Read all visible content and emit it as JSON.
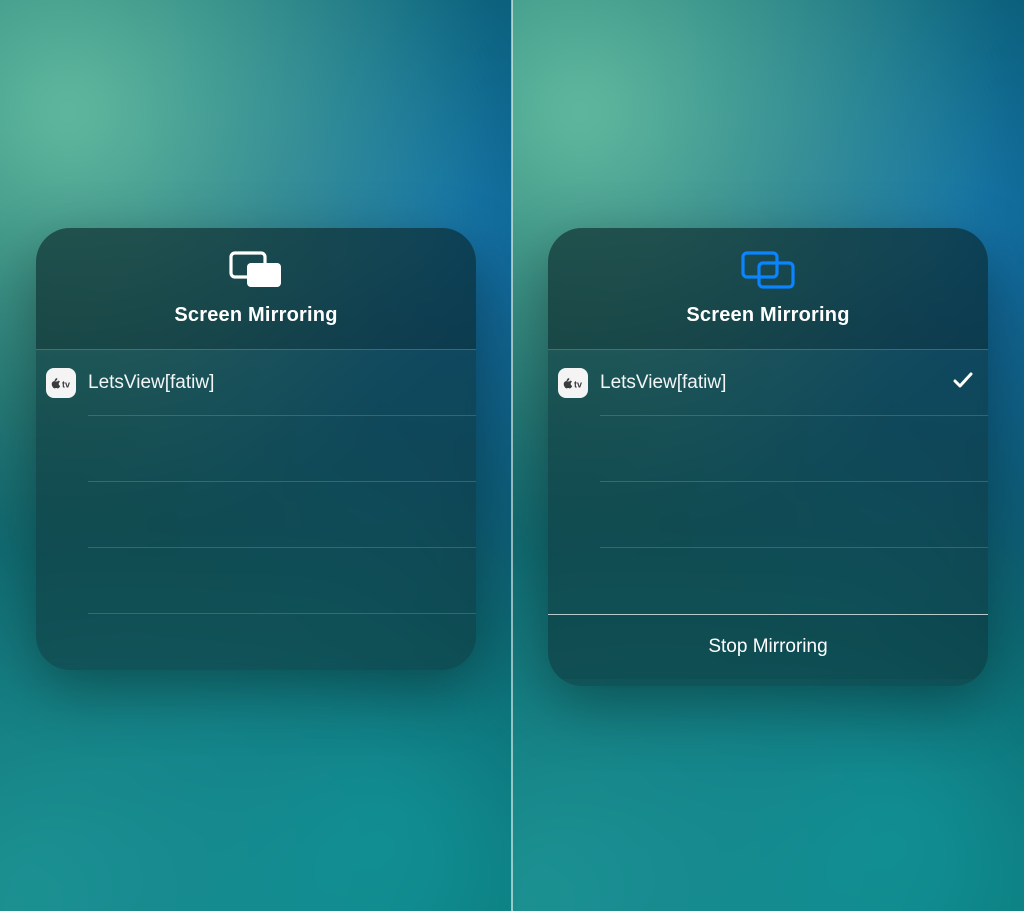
{
  "colors": {
    "icon_inactive": "#ffffff",
    "icon_active": "#0a84ff",
    "badge_bg": "#f4f4f4",
    "badge_fg": "#3b3b3b"
  },
  "left": {
    "title": "Screen Mirroring",
    "icon_name": "screen-mirroring-icon",
    "device": {
      "label": "LetsView[fatiw]",
      "selected": false
    }
  },
  "right": {
    "title": "Screen Mirroring",
    "icon_name": "screen-mirroring-icon",
    "device": {
      "label": "LetsView[fatiw]",
      "selected": true
    },
    "stop_label": "Stop Mirroring"
  }
}
